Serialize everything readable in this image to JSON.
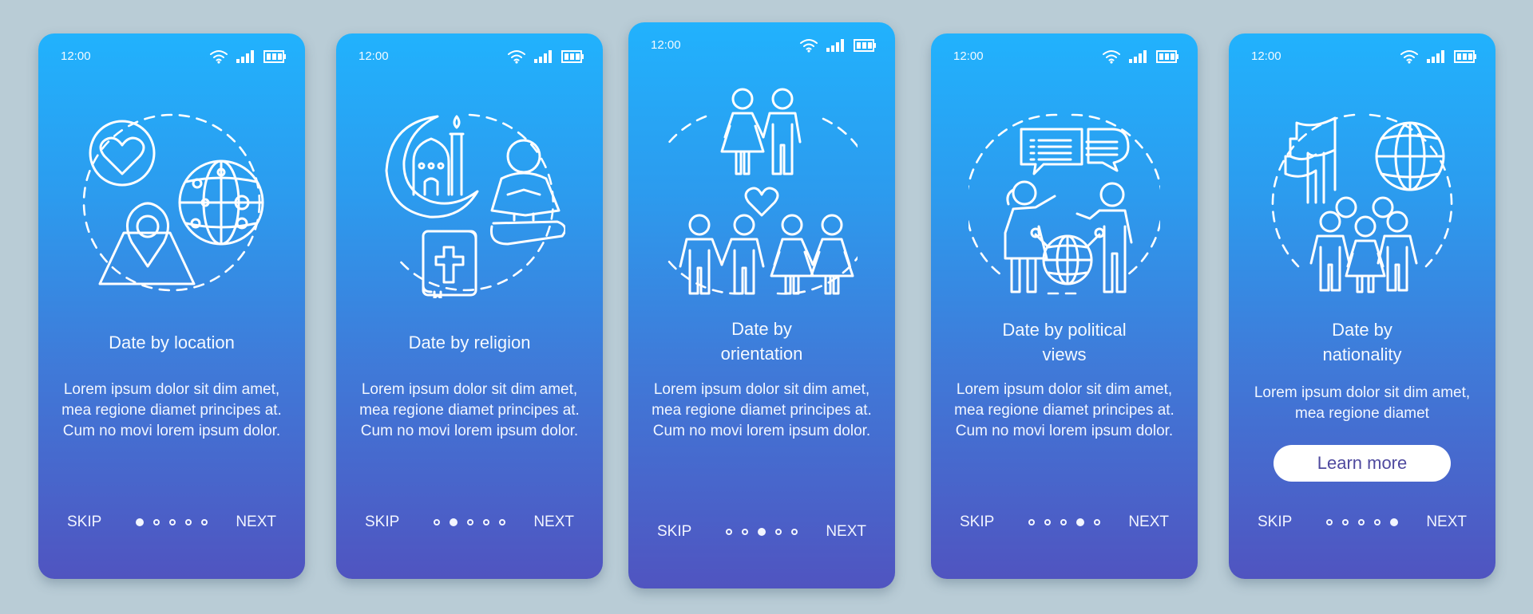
{
  "colors": {
    "background": "#b9ccd6",
    "gradient_top": "#21b2fd",
    "gradient_bottom": "#5054c0",
    "button_text": "#4f4a9f"
  },
  "status_bar": {
    "time": "12:00",
    "icons": [
      "wifi-icon",
      "signal-icon",
      "battery-icon"
    ]
  },
  "nav": {
    "skip_label": "SKIP",
    "next_label": "NEXT",
    "total_pages": 5
  },
  "screens": [
    {
      "title": "Date by location",
      "body": "Lorem ipsum dolor sit dim amet, mea regione diamet principes at. Cum no movi lorem ipsum dolor.",
      "illustration": "location-dating-icon",
      "active_page": 1
    },
    {
      "title": "Date by religion",
      "body": "Lorem ipsum dolor sit dim amet, mea regione diamet principes at. Cum no movi lorem ipsum dolor.",
      "illustration": "religion-dating-icon",
      "active_page": 2
    },
    {
      "title": "Date by orientation",
      "body": "Lorem ipsum dolor sit dim amet, mea regione diamet principes at. Cum no movi lorem ipsum dolor.",
      "illustration": "orientation-dating-icon",
      "active_page": 3
    },
    {
      "title": "Date by political views",
      "body": "Lorem ipsum dolor sit dim amet, mea regione diamet principes at. Cum no movi lorem ipsum dolor.",
      "illustration": "political-views-dating-icon",
      "active_page": 4
    },
    {
      "title": "Date by nationality",
      "body": "Lorem ipsum dolor sit dim amet, mea regione diamet",
      "illustration": "nationality-dating-icon",
      "active_page": 5,
      "button_label": "Learn more"
    }
  ]
}
